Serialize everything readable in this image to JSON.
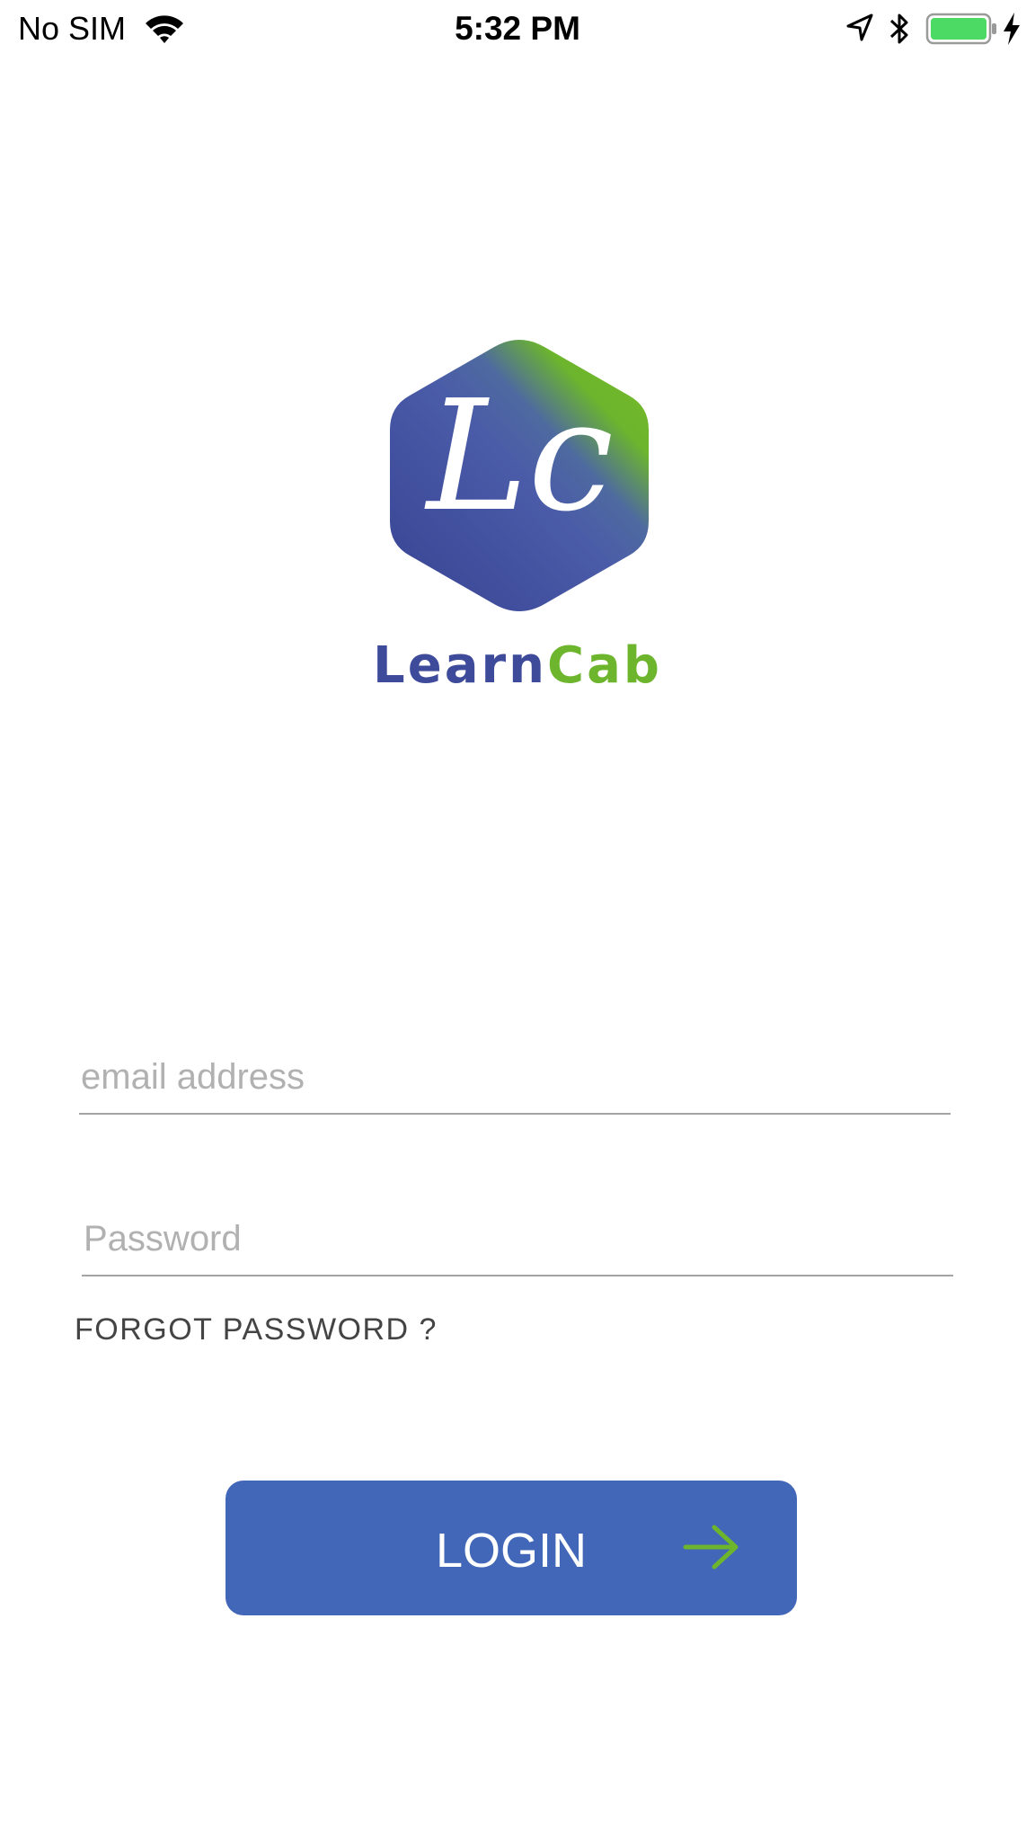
{
  "status_bar": {
    "carrier": "No SIM",
    "time": "5:32 PM",
    "battery_color": "#4cd964",
    "icons": [
      "wifi-icon",
      "location-icon",
      "bluetooth-icon",
      "battery-icon",
      "charging-icon"
    ]
  },
  "brand": {
    "name_part_1": "Learn",
    "name_part_2": "Cab",
    "logo_monogram": "Lc",
    "primary_color": "#3e4a9a",
    "accent_color": "#6cb52d"
  },
  "form": {
    "email_placeholder": "email address",
    "email_value": "",
    "password_placeholder": "Password",
    "password_value": "",
    "forgot_label": "FORGOT PASSWORD ?"
  },
  "login_button": {
    "label": "LOGIN",
    "color": "#4267b8",
    "icon": "arrow-right-icon"
  }
}
